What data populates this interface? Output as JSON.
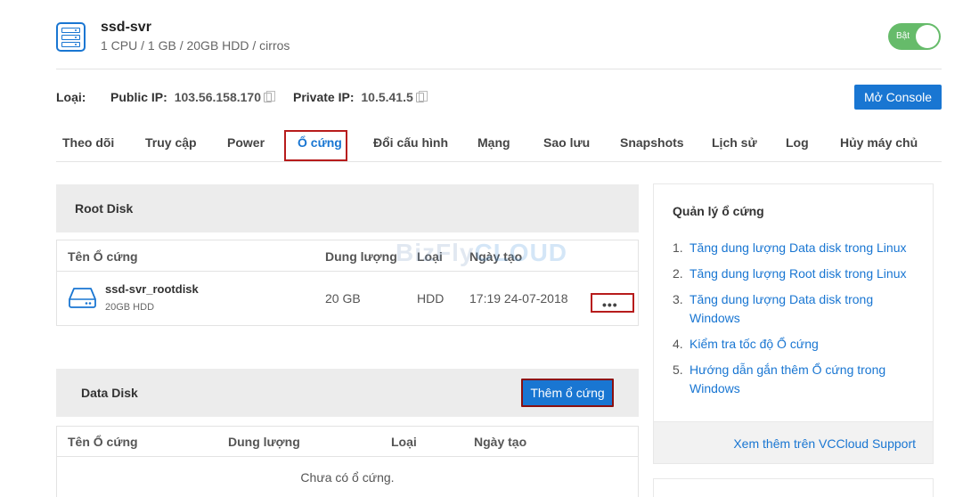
{
  "server": {
    "name": "ssd-svr",
    "spec": "1 CPU / 1 GB / 20GB HDD / cirros",
    "icon": "server-icon",
    "power_toggle_label": "Bật",
    "power_on": true
  },
  "info": {
    "type_label": "Loại:",
    "public_ip_label": "Public IP:",
    "public_ip": "103.56.158.170",
    "private_ip_label": "Private IP:",
    "private_ip": "10.5.41.5",
    "console_button": "Mở Console"
  },
  "tabs": [
    {
      "label": "Theo dõi"
    },
    {
      "label": "Truy cập"
    },
    {
      "label": "Power"
    },
    {
      "label": "Ổ cứng"
    },
    {
      "label": "Đổi cấu hình"
    },
    {
      "label": "Mạng"
    },
    {
      "label": "Sao lưu"
    },
    {
      "label": "Snapshots"
    },
    {
      "label": "Lịch sử"
    },
    {
      "label": "Log"
    },
    {
      "label": "Hủy máy chủ"
    }
  ],
  "active_tab": "Ổ cứng",
  "root_disk": {
    "title": "Root Disk",
    "columns": [
      "Tên Ổ cứng",
      "Dung lượng",
      "Loại",
      "Ngày tạo"
    ],
    "rows": [
      {
        "name": "ssd-svr_rootdisk",
        "sub": "20GB HDD",
        "size": "20 GB",
        "type": "HDD",
        "created": "17:19 24-07-2018",
        "actions": "•••"
      }
    ]
  },
  "watermark": {
    "brand": "BizFly",
    "suffix": "CLOUD"
  },
  "data_disk": {
    "title": "Data Disk",
    "add_button": "Thêm ổ cứng",
    "columns": [
      "Tên Ổ cứng",
      "Dung lượng",
      "Loại",
      "Ngày tạo"
    ],
    "empty_text": "Chưa có ổ cứng."
  },
  "sidebar": {
    "title": "Quản lý ổ cứng",
    "links": [
      {
        "num": "1.",
        "label": "Tăng dung lượng Data disk trong Linux"
      },
      {
        "num": "2.",
        "label": "Tăng dung lượng Root disk trong Linux"
      },
      {
        "num": "3.",
        "label": "Tăng dung lượng Data disk trong Windows"
      },
      {
        "num": "4.",
        "label": "Kiểm tra tốc độ Ổ cứng"
      },
      {
        "num": "5.",
        "label": "Hướng dẫn gắn thêm Ổ cứng trong Windows"
      }
    ],
    "footer_link": "Xem thêm trên VCCloud Support"
  },
  "colors": {
    "accent": "#1976d2",
    "toggle_on": "#66bb6a",
    "highlight_border": "#b71c1c",
    "panel_bg": "#ececec"
  }
}
